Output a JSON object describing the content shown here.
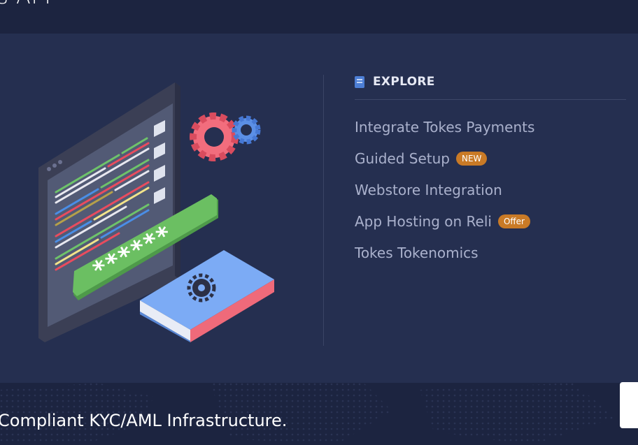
{
  "header": {
    "title": "s API"
  },
  "explore": {
    "icon": "book-icon",
    "title": "EXPLORE",
    "links": [
      {
        "label": "Integrate Tokes Payments",
        "badge": ""
      },
      {
        "label": "Guided Setup",
        "badge": "NEW"
      },
      {
        "label": "Webstore Integration",
        "badge": ""
      },
      {
        "label": "App Hosting on Reli",
        "badge": "Offer"
      },
      {
        "label": "Tokes Tokenomics",
        "badge": ""
      }
    ]
  },
  "illustration": {
    "password_mask": "******"
  },
  "footer": {
    "tagline": "Compliant KYC/AML Infrastructure."
  },
  "colors": {
    "background": "#1c2440",
    "panel": "#252f50",
    "badge": "#c97a26",
    "link": "#aab1cc"
  }
}
